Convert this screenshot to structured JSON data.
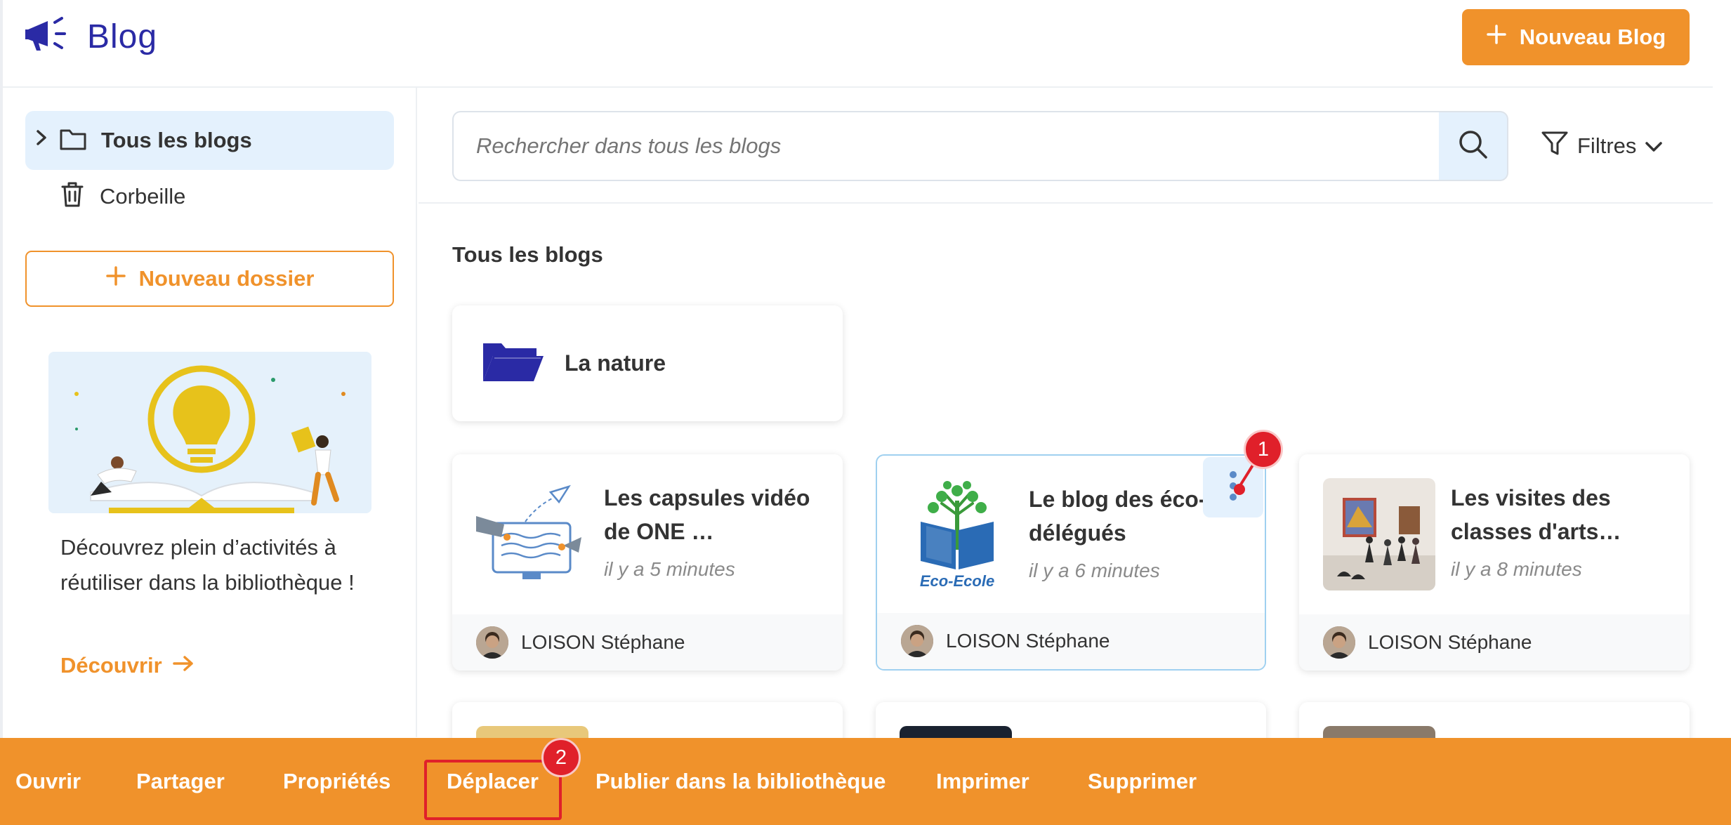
{
  "header": {
    "app_title": "Blog",
    "new_blog_label": "Nouveau Blog"
  },
  "sidebar": {
    "items": [
      {
        "label": "Tous les blogs",
        "icon": "folder-icon",
        "active": true
      },
      {
        "label": "Corbeille",
        "icon": "trash-icon",
        "active": false
      }
    ],
    "new_folder_label": "Nouveau dossier",
    "promo": {
      "text": "Découvrez plein d’activités à réutiliser dans la bibliothèque !",
      "link_label": "Découvrir"
    }
  },
  "search": {
    "placeholder": "Rechercher dans tous les blogs",
    "filters_label": "Filtres"
  },
  "main": {
    "section_title": "Tous les blogs",
    "folders": [
      {
        "label": "La nature"
      }
    ],
    "blogs": [
      {
        "title": "Les capsules vidéo de ONE …",
        "time": "il y a 5 minutes",
        "author": "LOISON Stéphane",
        "selected": false
      },
      {
        "title": "Le blog des éco-délégués",
        "time": "il y a 6 minutes",
        "author": "LOISON Stéphane",
        "selected": true,
        "thumb_caption": "Eco-Ecole"
      },
      {
        "title": "Les visites des classes d'arts…",
        "time": "il y a 8 minutes",
        "author": "LOISON Stéphane",
        "selected": false
      }
    ]
  },
  "actionbar": {
    "items": [
      {
        "label": "Ouvrir"
      },
      {
        "label": "Partager"
      },
      {
        "label": "Propriétés"
      },
      {
        "label": "Déplacer"
      },
      {
        "label": "Publier dans la bibliothèque"
      },
      {
        "label": "Imprimer"
      },
      {
        "label": "Supprimer"
      }
    ]
  },
  "annotations": {
    "badge_1": "1",
    "badge_2": "2"
  },
  "colors": {
    "accent": "#f0922b",
    "brand": "#2a2aa5",
    "active_bg": "#e4f1fd",
    "annotation_red": "#e0202a"
  }
}
